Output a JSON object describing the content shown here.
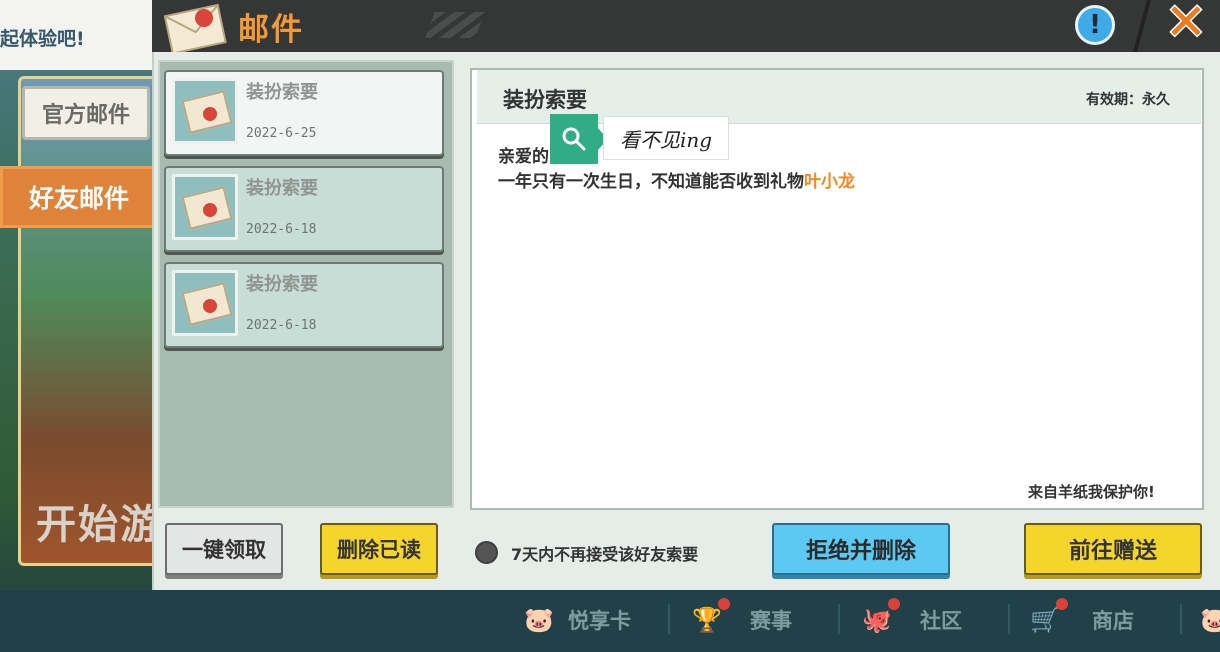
{
  "background": {
    "top_text": "起体验吧!",
    "banner_tab": "官方邮件",
    "start_text": "开始游",
    "side_tab_active": "好友邮件"
  },
  "dialog": {
    "title": "邮件",
    "info_icon": "exclamation-icon",
    "close_icon": "close-x-icon"
  },
  "mail_list": {
    "items": [
      {
        "title": "装扮索要",
        "date": "2022-6-25",
        "selected": true
      },
      {
        "title": "装扮索要",
        "date": "2022-6-18",
        "selected": false
      },
      {
        "title": "装扮索要",
        "date": "2022-6-18",
        "selected": false
      }
    ],
    "claim_all_label": "一键领取",
    "delete_read_label": "删除已读"
  },
  "mail_content": {
    "title": "装扮索要",
    "validity": "有效期：永久",
    "greeting": "亲爱的",
    "line2_prefix": "一年只有一次生日，不知道能否收到礼物",
    "sender_name": "叶小龙",
    "signature": "来自羊纸我保护你!"
  },
  "watermark": {
    "icon": "search-icon",
    "text": "看不见ing"
  },
  "actions": {
    "refuse_option_label": "7天内不再接受该好友索要",
    "reject_delete_label": "拒绝并删除",
    "go_gift_label": "前往赠送"
  },
  "bottom_nav": {
    "items": [
      {
        "label": "悦享卡",
        "icon": "pig-card-icon"
      },
      {
        "label": "赛事",
        "icon": "trophy-icon"
      },
      {
        "label": "社区",
        "icon": "community-icon"
      },
      {
        "label": "商店",
        "icon": "cart-icon"
      }
    ]
  },
  "colors": {
    "accent_orange": "#f29a37",
    "button_yellow": "#f6d52a",
    "button_blue": "#5cc9f2",
    "highlight_name": "#f08a22"
  }
}
